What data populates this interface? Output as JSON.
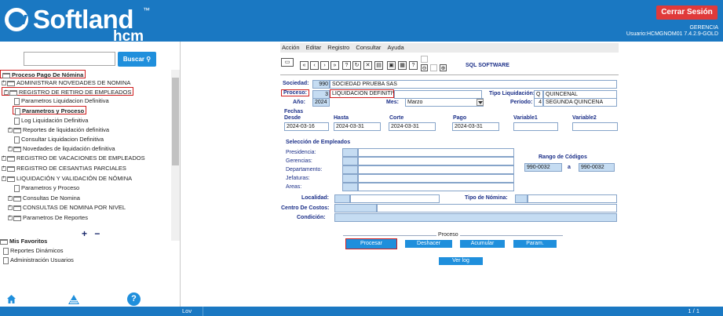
{
  "header": {
    "brand": "Softland",
    "brand_tm": "™",
    "brand_sub": "hcm",
    "logout_label": "Cerrar Sesión",
    "company": "GERENCIA",
    "user_line": "Usuario:HCMGNOM01 7.4.2.9-GOLD"
  },
  "sidebar": {
    "search_placeholder": "",
    "search_label": "Buscar",
    "tree": [
      {
        "label": "Proceso Pago De Nómina"
      },
      {
        "label": "ADMINISTRAR NOVEDADES DE NOMINA"
      },
      {
        "label": "REGISTRO DE RETIRO DE EMPLEADOS"
      },
      {
        "label": "Parametros Liquidacion Definitiva"
      },
      {
        "label": "Parametros y Proceso"
      },
      {
        "label": "Log Liquidación Definitiva"
      },
      {
        "label": "Reportes de liquidación definitiva"
      },
      {
        "label": "Consultar Liquidacion Definitiva"
      },
      {
        "label": "Novedades de liquidación definitiva"
      },
      {
        "label": "REGISTRO DE VACACIONES DE EMPLEADOS"
      },
      {
        "label": "REGISTRO DE CESANTIAS PARCIALES"
      },
      {
        "label": "LIQUIDACIÓN Y VALIDACIÓN DE NÓMINA"
      },
      {
        "label": "Parametros y Proceso"
      },
      {
        "label": "Consultas De Nomina"
      },
      {
        "label": "CONSULTAS DE NOMINA POR NIVEL"
      },
      {
        "label": "Parametros De Reportes"
      }
    ],
    "plus_minus": "+ −",
    "favorites": [
      {
        "label": "Mis Favoritos"
      },
      {
        "label": "Reportes Dinámicos"
      },
      {
        "label": "Administración Usuarios"
      }
    ],
    "help_label": "?"
  },
  "menu": [
    "Acción",
    "Editar",
    "Registro",
    "Consultar",
    "Ayuda"
  ],
  "toolbar": {
    "brand_label": "SQL SOFTWARE"
  },
  "form": {
    "sociedad_label": "Sociedad:",
    "sociedad_code": "990",
    "sociedad_name": "SOCIEDAD  PRUEBA SAS",
    "proceso_label": "Proceso:",
    "proceso_code": "3",
    "proceso_name": "LIQUIDACION DEFINITIVA",
    "tipo_liq_label": "Tipo Liquidación:",
    "tipo_liq_code": "Q",
    "tipo_liq_name": "QUINCENAL",
    "anio_label": "Año:",
    "anio_value": "2024",
    "mes_label": "Mes:",
    "mes_value": "Marzo",
    "periodo_label": "Período:",
    "periodo_code": "4",
    "periodo_name": "SEGUNDA QUINCENA",
    "fechas_label": "Fechas",
    "desde_label": "Desde",
    "desde_value": "2024-03-16",
    "hasta_label": "Hasta",
    "hasta_value": "2024-03-31",
    "corte_label": "Corte",
    "corte_value": "2024-03-31",
    "pago_label": "Pago",
    "pago_value": "2024-03-31",
    "variable1_label": "Variable1",
    "variable2_label": "Variable2",
    "seleccion_label": "Selección de Empleados",
    "presidencia_label": "Presidencia:",
    "gerencias_label": "Gerencias:",
    "departamento_label": "Departamento:",
    "jefaturas_label": "Jefaturas:",
    "areas_label": "Areas:",
    "rango_label": "Rango de Códigos",
    "rango_desde": "990-0032",
    "rango_a": "a",
    "rango_hasta": "990-0032",
    "localidad_label": "Localidad:",
    "tipo_nomina_label": "Tipo de Nómina:",
    "centro_costos_label": "Centro De Costos:",
    "condicion_label": "Condición:"
  },
  "proceso_panel": {
    "title": "Proceso",
    "procesar": "Procesar",
    "deshacer": "Deshacer",
    "acumular": "Acumular",
    "param": "Param.",
    "ver_log": "Ver log"
  },
  "status": {
    "left": "Lov",
    "right": "1 / 1"
  },
  "colors": {
    "brand_blue": "#1a78c2",
    "button_blue": "#1f8fdc",
    "logout_red": "#e03a3a",
    "highlight_red": "#d01e1e"
  }
}
